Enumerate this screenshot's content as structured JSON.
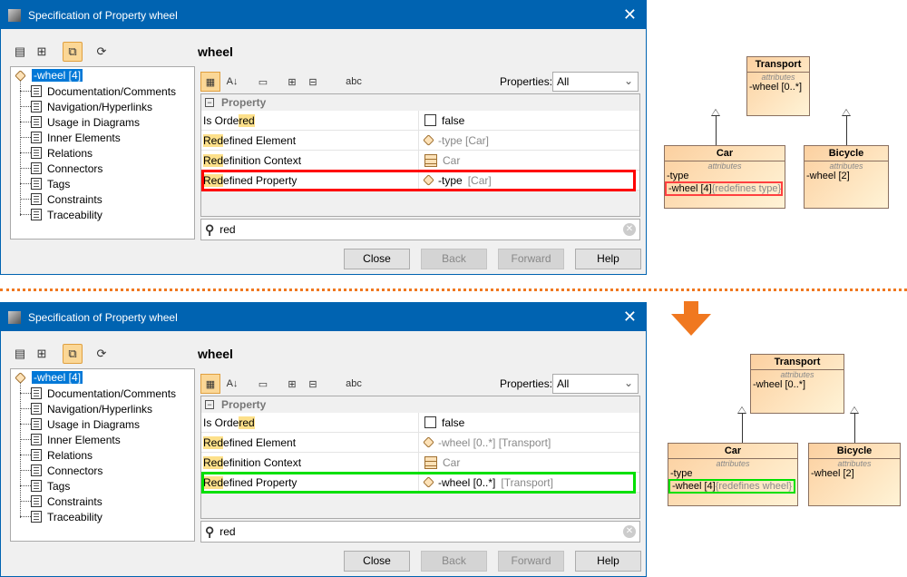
{
  "dialogs": [
    {
      "title": "Specification of Property wheel",
      "header": "wheel",
      "tree_root": "-wheel [4]",
      "tree_items": [
        "Documentation/Comments",
        "Navigation/Hyperlinks",
        "Usage in Diagrams",
        "Inner Elements",
        "Relations",
        "Connectors",
        "Tags",
        "Constraints",
        "Traceability"
      ],
      "properties_label": "Properties:",
      "properties_value": "All",
      "group": "Property",
      "rows": [
        {
          "pre": "Is Orde",
          "hl": "red",
          "post": "",
          "icon": "checkbox",
          "value": "false",
          "value_gray": ""
        },
        {
          "pre": "",
          "hl": "Red",
          "post": "efined Element",
          "icon": "property",
          "value": "",
          "value_gray": "-type [Car]"
        },
        {
          "pre": "",
          "hl": "Red",
          "post": "efinition Context",
          "icon": "class",
          "value": "",
          "value_gray": "Car"
        },
        {
          "pre": "",
          "hl": "Red",
          "post": "efined Property",
          "icon": "property",
          "value": "-type",
          "value_gray": "[Car]"
        }
      ],
      "highlight_color": "#ff0000",
      "search": "red",
      "buttons": [
        "Close",
        "Back",
        "Forward",
        "Help"
      ]
    },
    {
      "title": "Specification of Property wheel",
      "header": "wheel",
      "tree_root": "-wheel [4]",
      "tree_items": [
        "Documentation/Comments",
        "Navigation/Hyperlinks",
        "Usage in Diagrams",
        "Inner Elements",
        "Relations",
        "Connectors",
        "Tags",
        "Constraints",
        "Traceability"
      ],
      "properties_label": "Properties:",
      "properties_value": "All",
      "group": "Property",
      "rows": [
        {
          "pre": "Is Orde",
          "hl": "red",
          "post": "",
          "icon": "checkbox",
          "value": "false",
          "value_gray": ""
        },
        {
          "pre": "",
          "hl": "Red",
          "post": "efined Element",
          "icon": "property",
          "value": "",
          "value_gray": "-wheel [0..*] [Transport]"
        },
        {
          "pre": "",
          "hl": "Red",
          "post": "efinition Context",
          "icon": "class",
          "value": "",
          "value_gray": "Car"
        },
        {
          "pre": "",
          "hl": "Red",
          "post": "efined Property",
          "icon": "property",
          "value": "-wheel [0..*]",
          "value_gray": "[Transport]"
        }
      ],
      "highlight_color": "#00e000",
      "search": "red",
      "buttons": [
        "Close",
        "Back",
        "Forward",
        "Help"
      ]
    }
  ],
  "diagrams": [
    {
      "stereotype": "attributes",
      "transport": {
        "name": "Transport",
        "attrs": [
          "-wheel [0..*]"
        ]
      },
      "car": {
        "name": "Car",
        "attrs": [
          "-type"
        ],
        "hl_attr": "-wheel [4]",
        "hl_note": "{redefines type}"
      },
      "bicycle": {
        "name": "Bicycle",
        "attrs": [
          "-wheel [2]"
        ]
      },
      "highlight_color": "#ff4040"
    },
    {
      "stereotype": "attributes",
      "transport": {
        "name": "Transport",
        "attrs": [
          "-wheel [0..*]"
        ]
      },
      "car": {
        "name": "Car",
        "attrs": [
          "-type"
        ],
        "hl_attr": "-wheel [4]",
        "hl_note": "{redefines wheel}"
      },
      "bicycle": {
        "name": "Bicycle",
        "attrs": [
          "-wheel [2]"
        ]
      },
      "highlight_color": "#00e000"
    }
  ],
  "arrow_color": "#f07820"
}
